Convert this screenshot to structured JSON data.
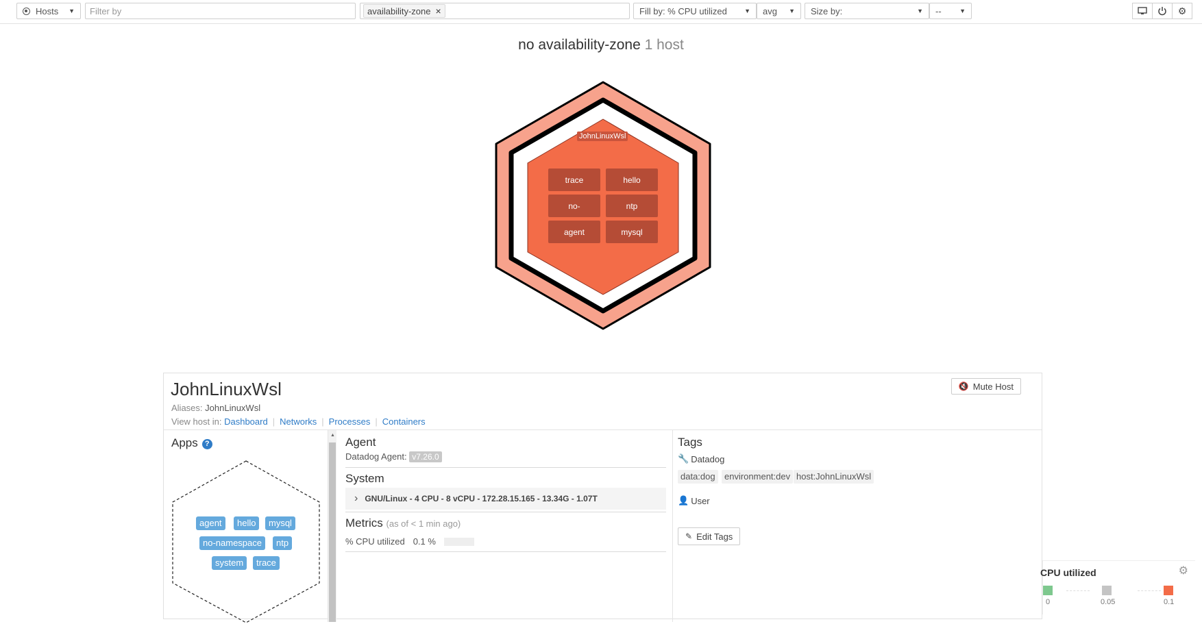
{
  "toolbar": {
    "hosts_select": "Hosts",
    "filter_placeholder": "Filter by",
    "group_chip": "availability-zone",
    "fill_select": "Fill by: % CPU utilized",
    "aggregation": "avg",
    "size_select": "Size by:",
    "size_aggregation": "--",
    "icons": [
      "monitor-icon",
      "power-icon",
      "gear-icon"
    ]
  },
  "map": {
    "zone_label": "no availability-zone",
    "host_count": "1 host",
    "host_label": "JohnLinuxWsl",
    "apps": [
      "trace",
      "hello",
      "no-",
      "ntp",
      "agent",
      "mysql"
    ],
    "host_fill_color": "#f36c48",
    "ring_color": "#f7a28c"
  },
  "host_panel": {
    "name": "JohnLinuxWsl",
    "aliases_label": "Aliases:",
    "aliases_value": "JohnLinuxWsl",
    "view_in_label": "View host in:",
    "view_links": [
      "Dashboard",
      "Networks",
      "Processes",
      "Containers"
    ],
    "mute_button": "Mute Host",
    "apps_title": "Apps",
    "apps": [
      "agent",
      "hello",
      "mysql",
      "no-namespace",
      "ntp",
      "system",
      "trace"
    ],
    "agent_title": "Agent",
    "agent_label": "Datadog Agent:",
    "agent_version": "v7.26.0",
    "system_title": "System",
    "system_summary": "GNU/Linux - 4 CPU - 8 vCPU - 172.28.15.165 - 13.34G - 1.07T",
    "metrics_title": "Metrics",
    "metrics_subtitle": "(as of < 1 min ago)",
    "cpu_label": "% CPU utilized",
    "cpu_value": "0.1 %",
    "tags_title": "Tags",
    "datadog_source": "Datadog",
    "tags": [
      "data:dog",
      "environment:dev",
      "host:JohnLinuxWsl"
    ],
    "user_source": "User",
    "edit_tags": "Edit Tags"
  },
  "legend": {
    "title": "CPU utilized",
    "stops": [
      "0",
      "0.05",
      "0.1"
    ],
    "colors": [
      "#7ec88e",
      "#c4c4c4",
      "#f36c48"
    ]
  }
}
